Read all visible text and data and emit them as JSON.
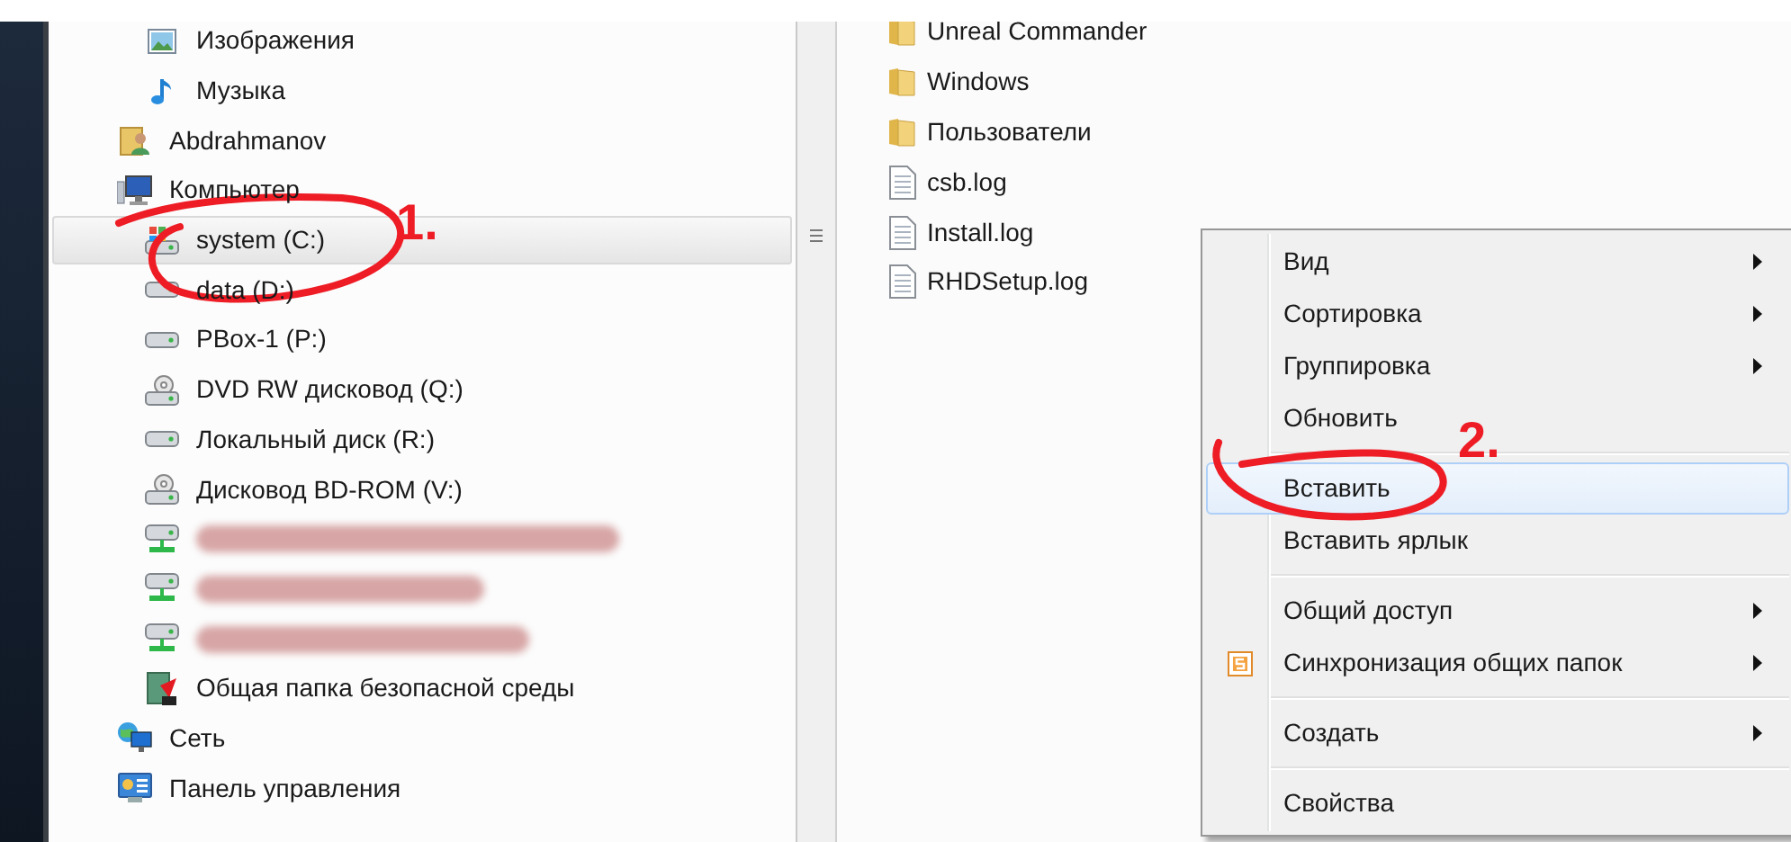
{
  "tree": [
    {
      "kind": "continued",
      "children": [
        {
          "kind": "pictures",
          "label": "Изображения",
          "selected": false
        },
        {
          "kind": "music",
          "label": "Музыка",
          "selected": false
        }
      ]
    },
    {
      "kind": "user",
      "label": "Abdrahmanov",
      "selected": false
    },
    {
      "kind": "computer",
      "label": "Компьютер",
      "selected": false,
      "children": [
        {
          "kind": "system-drive",
          "label": "system (C:)",
          "selected": true
        },
        {
          "kind": "drive",
          "label": "data (D:)",
          "selected": false
        },
        {
          "kind": "drive",
          "label": "PBox-1 (P:)",
          "selected": false
        },
        {
          "kind": "optical",
          "label": "DVD RW дисковод (Q:)",
          "selected": false
        },
        {
          "kind": "drive",
          "label": "Локальный диск (R:)",
          "selected": false
        },
        {
          "kind": "optical",
          "label": "Дисковод BD-ROM (V:)",
          "selected": false
        },
        {
          "kind": "network-drive",
          "redacted": true,
          "selected": false
        },
        {
          "kind": "network-drive",
          "redacted": true,
          "selected": false
        },
        {
          "kind": "network-drive",
          "redacted": true,
          "selected": false
        },
        {
          "kind": "safe-folder",
          "label": "Общая папка безопасной среды",
          "selected": false
        }
      ]
    },
    {
      "kind": "network",
      "label": "Сеть",
      "selected": false
    },
    {
      "kind": "control-panel",
      "label": "Панель управления",
      "selected": false
    }
  ],
  "files": [
    {
      "kind": "folder",
      "label": "Unreal Commander"
    },
    {
      "kind": "folder",
      "label": "Windows"
    },
    {
      "kind": "folder",
      "label": "Пользователи"
    },
    {
      "kind": "file",
      "label": "csb.log"
    },
    {
      "kind": "file",
      "label": "Install.log"
    },
    {
      "kind": "file",
      "label": "RHDSetup.log"
    }
  ],
  "context_menu": [
    {
      "kind": "item",
      "label": "Вид",
      "submenu": true,
      "selected": false,
      "has_icon": false
    },
    {
      "kind": "item",
      "label": "Сортировка",
      "submenu": true,
      "selected": false,
      "has_icon": false
    },
    {
      "kind": "item",
      "label": "Группировка",
      "submenu": true,
      "selected": false,
      "has_icon": false
    },
    {
      "kind": "item",
      "label": "Обновить",
      "submenu": false,
      "selected": false,
      "has_icon": false
    },
    {
      "kind": "separator"
    },
    {
      "kind": "item",
      "label": "Вставить",
      "submenu": false,
      "selected": true,
      "has_icon": false
    },
    {
      "kind": "item",
      "label": "Вставить ярлык",
      "submenu": false,
      "selected": false,
      "has_icon": false
    },
    {
      "kind": "separator"
    },
    {
      "kind": "item",
      "label": "Общий доступ",
      "submenu": true,
      "selected": false,
      "has_icon": false
    },
    {
      "kind": "item",
      "label": "Синхронизация общих папок",
      "submenu": true,
      "selected": false,
      "has_icon": true
    },
    {
      "kind": "separator"
    },
    {
      "kind": "item",
      "label": "Создать",
      "submenu": true,
      "selected": false,
      "has_icon": false
    },
    {
      "kind": "separator"
    },
    {
      "kind": "item",
      "label": "Свойства",
      "submenu": false,
      "selected": false,
      "has_icon": false
    }
  ],
  "annotations": [
    {
      "label": "1."
    },
    {
      "label": "2."
    }
  ]
}
